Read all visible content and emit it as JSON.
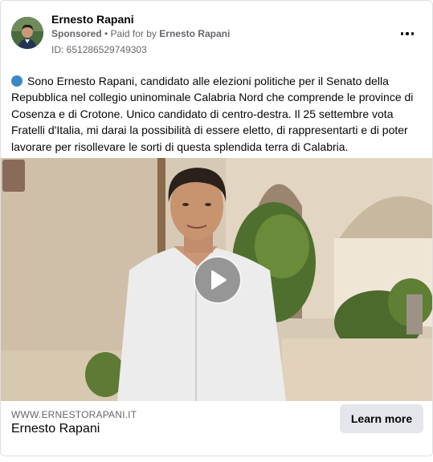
{
  "header": {
    "advertiser_name": "Ernesto Rapani",
    "sponsored_label": "Sponsored",
    "separator": " • ",
    "paid_for_by_label": "Paid for by",
    "paid_for_by_name": "Ernesto Rapani",
    "ad_id": "ID: 651286529749303",
    "more_icon": "more-horizontal-icon"
  },
  "post": {
    "icon": "blue-circle-emoji",
    "text": "Sono Ernesto Rapani, candidato alle elezioni politiche per il Senato della Repubblica nel collegio uninominale Calabria Nord che comprende le province di Cosenza e di Crotone. Unico candidato di centro-destra. Il 25 settembre vota Fratelli d'Italia, mi darai la possibilità di essere eletto, di rappresentarti e di poter lavorare per risollevare le sorti di questa splendida terra di Calabria."
  },
  "video": {
    "play_icon": "play-icon"
  },
  "footer": {
    "link_url": "WWW.ERNESTORAPANI.IT",
    "link_title": "Ernesto Rapani",
    "cta_label": "Learn more"
  },
  "colors": {
    "card_border": "#dddfe2",
    "secondary_text": "#65676b",
    "cta_background": "#e4e6eb",
    "blue_dot": "#3b88c3"
  }
}
